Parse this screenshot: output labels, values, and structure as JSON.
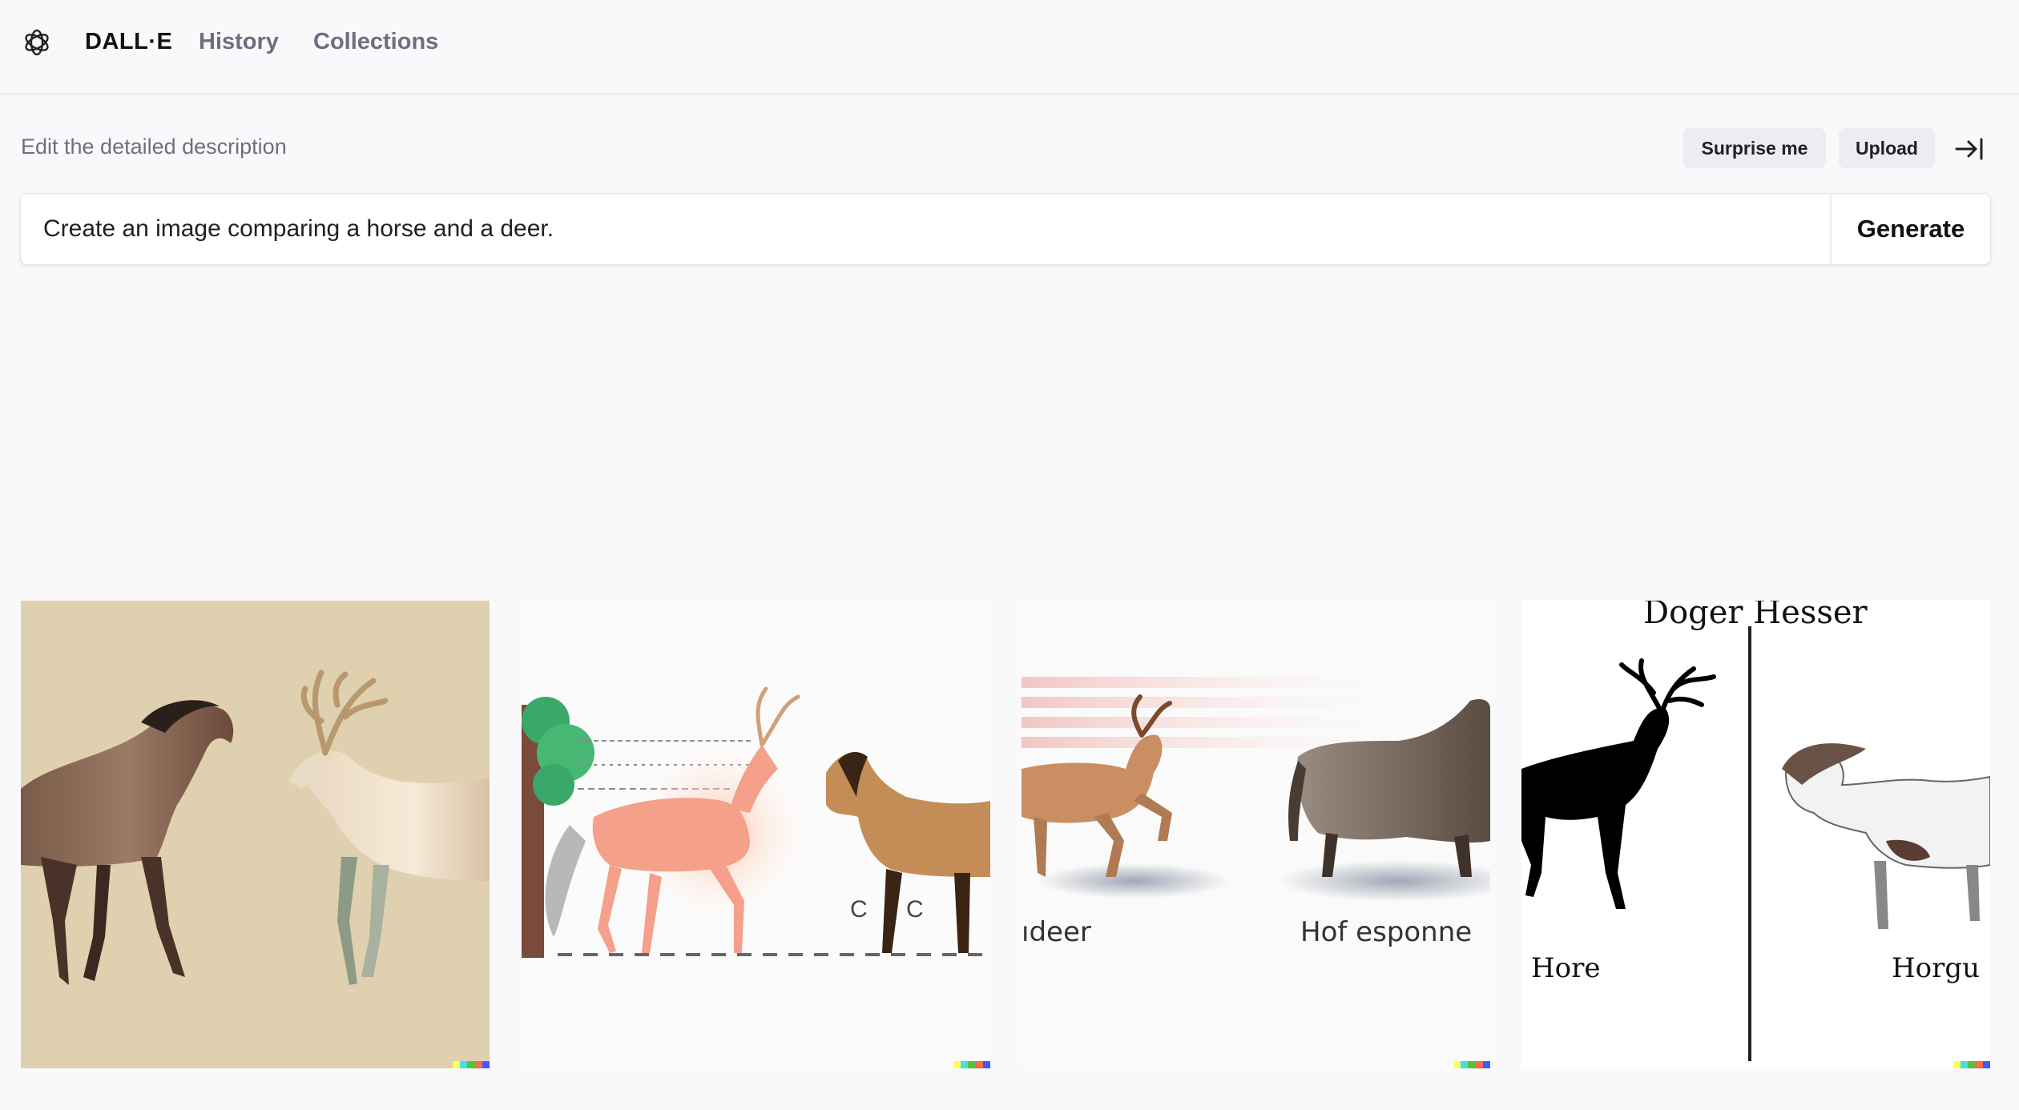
{
  "nav": {
    "brand": "DALL·E",
    "history": "History",
    "collections": "Collections"
  },
  "prompt": {
    "label": "Edit the detailed description",
    "surprise_label": "Surprise me",
    "upload_label": "Upload",
    "value": "Create an image comparing a horse and a deer.",
    "generate_label": "Generate"
  },
  "results": [
    {
      "texts": []
    },
    {
      "texts": [
        "C",
        "C"
      ]
    },
    {
      "texts": [
        "ıdeer",
        "Hof esponne"
      ]
    },
    {
      "texts": [
        "Doger Hesser",
        "Hore",
        "Horgu"
      ]
    }
  ],
  "signature_colors": [
    "#fffe5c",
    "#43e0e0",
    "#52c23f",
    "#ff6b3f",
    "#3a5cff"
  ],
  "colors": {
    "page_bg": "#f9f9fb",
    "pill_bg": "#ececf1",
    "muted_text": "#6e6e80"
  }
}
